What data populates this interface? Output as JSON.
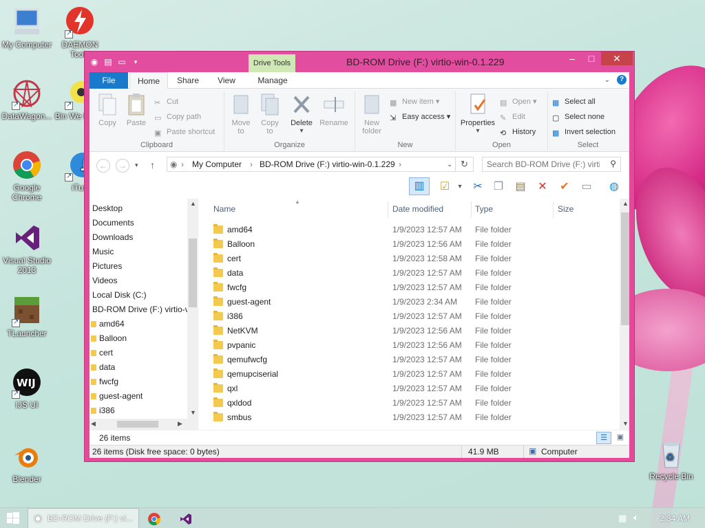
{
  "desktop": {
    "icons": [
      {
        "label": "My Computer"
      },
      {
        "label": "DAEMON Tools"
      },
      {
        "label": "DataWagon..."
      },
      {
        "label": "Bin We Rewri"
      },
      {
        "label": "Google Chrome"
      },
      {
        "label": "iTun"
      },
      {
        "label": "Visual Studio 2013"
      },
      {
        "label": "TLauncher"
      },
      {
        "label": "IJS UI"
      },
      {
        "label": "Blender"
      },
      {
        "label": "Recycle Bin"
      }
    ]
  },
  "window": {
    "title": "BD-ROM Drive (F:) virtio-win-0.1.229",
    "contextual_tab": "Drive Tools"
  },
  "ribbon": {
    "tabs": [
      "File",
      "Home",
      "Share",
      "View",
      "Manage"
    ],
    "clipboard": {
      "copy": "Copy",
      "paste": "Paste",
      "cut": "Cut",
      "copy_path": "Copy path",
      "paste_shortcut": "Paste shortcut",
      "label": "Clipboard"
    },
    "organize": {
      "move_to_1": "Move",
      "move_to_2": "to",
      "copy_to_1": "Copy",
      "copy_to_2": "to",
      "delete": "Delete",
      "rename": "Rename",
      "label": "Organize"
    },
    "new": {
      "new_folder_1": "New",
      "new_folder_2": "folder",
      "new_item": "New item",
      "easy_access": "Easy access",
      "label": "New"
    },
    "open": {
      "properties": "Properties",
      "open": "Open",
      "edit": "Edit",
      "history": "History",
      "label": "Open"
    },
    "select": {
      "select_all": "Select all",
      "select_none": "Select none",
      "invert": "Invert selection",
      "label": "Select"
    }
  },
  "address": {
    "crumbs": [
      "My Computer",
      "BD-ROM Drive (F:) virtio-win-0.1.229"
    ],
    "search_placeholder": "Search BD-ROM Drive (F:) virti..."
  },
  "nav": {
    "items": [
      "Desktop",
      "Documents",
      "Downloads",
      "Music",
      "Pictures",
      "Videos",
      "Local Disk (C:)",
      "BD-ROM Drive (F:) virtio-v"
    ],
    "subitems": [
      "amd64",
      "Balloon",
      "cert",
      "data",
      "fwcfg",
      "guest-agent",
      "i386"
    ]
  },
  "columns": {
    "name": "Name",
    "date": "Date modified",
    "type": "Type",
    "size": "Size"
  },
  "files": [
    {
      "name": "amd64",
      "date": "1/9/2023 12:57 AM",
      "type": "File folder"
    },
    {
      "name": "Balloon",
      "date": "1/9/2023 12:56 AM",
      "type": "File folder"
    },
    {
      "name": "cert",
      "date": "1/9/2023 12:58 AM",
      "type": "File folder"
    },
    {
      "name": "data",
      "date": "1/9/2023 12:57 AM",
      "type": "File folder"
    },
    {
      "name": "fwcfg",
      "date": "1/9/2023 12:57 AM",
      "type": "File folder"
    },
    {
      "name": "guest-agent",
      "date": "1/9/2023 2:34 AM",
      "type": "File folder"
    },
    {
      "name": "i386",
      "date": "1/9/2023 12:57 AM",
      "type": "File folder"
    },
    {
      "name": "NetKVM",
      "date": "1/9/2023 12:56 AM",
      "type": "File folder"
    },
    {
      "name": "pvpanic",
      "date": "1/9/2023 12:56 AM",
      "type": "File folder"
    },
    {
      "name": "qemufwcfg",
      "date": "1/9/2023 12:57 AM",
      "type": "File folder"
    },
    {
      "name": "qemupciserial",
      "date": "1/9/2023 12:57 AM",
      "type": "File folder"
    },
    {
      "name": "qxl",
      "date": "1/9/2023 12:57 AM",
      "type": "File folder"
    },
    {
      "name": "qxldod",
      "date": "1/9/2023 12:57 AM",
      "type": "File folder"
    },
    {
      "name": "smbus",
      "date": "1/9/2023 12:57 AM",
      "type": "File folder"
    }
  ],
  "status": {
    "item_count": "26 items",
    "summary": "26 items (Disk free space: 0 bytes)",
    "size": "41.9 MB",
    "location": "Computer"
  },
  "taskbar": {
    "task_label": "BD-ROM Drive (F:) vi...",
    "clock": "2:34 AM"
  },
  "colors": {
    "accent": "#e54a9a",
    "file_tab": "#1979ca",
    "folder": "#f3c94e"
  }
}
